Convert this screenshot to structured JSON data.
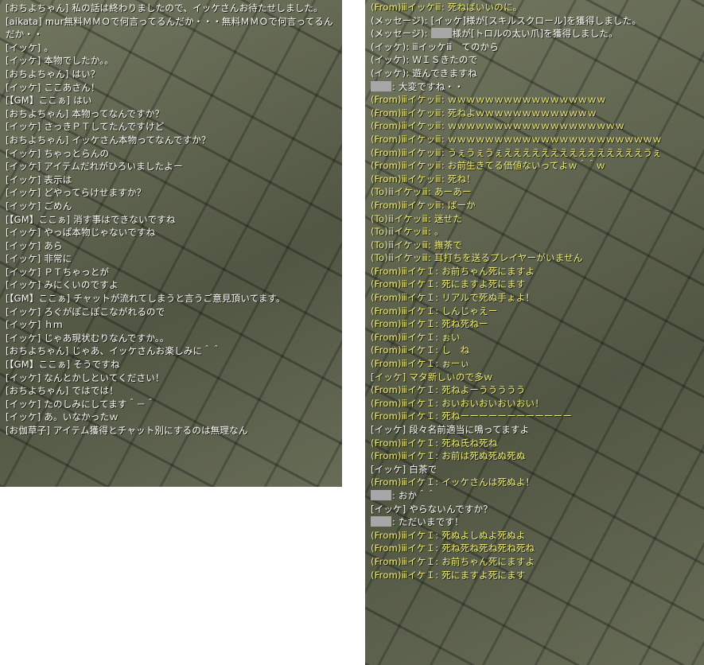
{
  "colors": {
    "normal": "#ffffff",
    "whisper": "#f2ef7a",
    "background": "#5f6450"
  },
  "left_panel": {
    "lines": [
      {
        "type": "normal",
        "text": "[おちよちゃん] 私の話は終わりましたので、イッケさんお待たせしました。"
      },
      {
        "type": "normal",
        "text": "[aikata] mur無料ＭＭＯで何言ってるんだか・・・無料ＭＭＯで何言ってるんだか・・"
      },
      {
        "type": "normal",
        "text": "[イッケ] 。"
      },
      {
        "type": "normal",
        "text": "[イッケ] 本物でしたか。。"
      },
      {
        "type": "normal",
        "text": "[おちよちゃん] はい？"
      },
      {
        "type": "normal",
        "text": "[イッケ] ここあさん！"
      },
      {
        "type": "normal",
        "text": "[【GM】ここぁ] はい"
      },
      {
        "type": "normal",
        "text": "[おちよちゃん] 本物ってなんですか？"
      },
      {
        "type": "normal",
        "text": "[イッケ] さっきＰＴしてたんですけど"
      },
      {
        "type": "normal",
        "text": "[おちよちゃん] イッケさん本物ってなんですか？"
      },
      {
        "type": "normal",
        "text": "[イッケ] ちゃっとらんの"
      },
      {
        "type": "normal",
        "text": "[イッケ] アイテムだれがひろいましたよー"
      },
      {
        "type": "normal",
        "text": "[イッケ] 表示は"
      },
      {
        "type": "normal",
        "text": "[イッケ] どやってらけせますか？"
      },
      {
        "type": "normal",
        "text": "[イッケ] ごめん"
      },
      {
        "type": "normal",
        "text": "[【GM】ここぁ] 消す事はできないですね"
      },
      {
        "type": "normal",
        "text": "[イッケ] やっぱ本物じゃないですね"
      },
      {
        "type": "normal",
        "text": "[イッケ] あら"
      },
      {
        "type": "normal",
        "text": "[イッケ] 非常に"
      },
      {
        "type": "normal",
        "text": "[イッケ] ＰＴちゃっとが"
      },
      {
        "type": "normal",
        "text": "[イッケ] みにくいのですよ"
      },
      {
        "type": "normal",
        "text": "[【GM】ここぁ] チャットが流れてしまうと言うご意見頂いてます。"
      },
      {
        "type": "normal",
        "text": "[イッケ] ろぐがぽこぽこながれるので"
      },
      {
        "type": "normal",
        "text": "[イッケ] ｈｍ"
      },
      {
        "type": "normal",
        "text": "[イッケ] じゃあ現状むりなんですか。。"
      },
      {
        "type": "normal",
        "text": "[おちよちゃん] じゃあ、イッケさんお楽しみに＾＾"
      },
      {
        "type": "normal",
        "text": "[【GM】ここぁ] そうですね"
      },
      {
        "type": "normal",
        "text": "[イッケ] なんとかしといてください！"
      },
      {
        "type": "normal",
        "text": "[おちよちゃん] ではでは！"
      },
      {
        "type": "normal",
        "text": "[イッケ] たのしみにしてます＾－＾"
      },
      {
        "type": "normal",
        "text": "[イッケ] あ。いなかったｗ"
      },
      {
        "type": "normal",
        "text": "[お伽草子] アイテム獲得とチャット別にするのは無理なん"
      }
    ]
  },
  "right_panel": {
    "lines": [
      {
        "type": "whisper",
        "text": "(From)ⅲイッケⅲ: 死ねばいいのに。"
      },
      {
        "type": "system",
        "text": "(メッセージ): [イッケ]様が[スキルスクロール]を獲得しました。"
      },
      {
        "type": "system",
        "redacted": true,
        "text_before": "(メッセージ): ",
        "text": "様が[トロルの太い爪]を獲得しました。"
      },
      {
        "type": "system",
        "text": "(イッケ): ⅲイッケⅲ　てのから"
      },
      {
        "type": "system",
        "text": "(イッケ): ＷＩＳきたので"
      },
      {
        "type": "system",
        "text": "(イッケ): 遊んできますね"
      },
      {
        "type": "system",
        "redacted": true,
        "text_before": "",
        "text": ": 大変ですね・・"
      },
      {
        "type": "whisper",
        "text": "(From)ⅲイケッⅲ: ｗｗｗｗｗｗｗｗｗｗｗｗｗｗｗｗｗ"
      },
      {
        "type": "whisper",
        "text": "(From)ⅲイケッⅲ: 死ねよｗｗｗｗｗｗｗｗｗｗｗｗｗ"
      },
      {
        "type": "whisper",
        "text": "(From)ⅲイケッⅲ: ｗｗｗｗｗｗｗｗｗｗｗｗｗｗｗｗｗｗｗ"
      },
      {
        "type": "whisper",
        "text": "(From)ⅲイケッⅲ: ｗｗｗｗｗｗｗｗｗｗｗｗｗｗｗｗｗｗｗｗｗｗｗ"
      },
      {
        "type": "whisper",
        "text": "(From)ⅲイケッⅲ: うぇうぇうぇえええええええええええええええうぇ"
      },
      {
        "type": "whisper",
        "text": "(From)ⅲイケッⅲ: お前生きてる価値ないってよｗ＾＾ｗ"
      },
      {
        "type": "whisper",
        "text": "(From)ⅲイケッⅲ: 死ね！"
      },
      {
        "type": "whisper",
        "text": "(To)ⅲイケッⅲ: あーあー"
      },
      {
        "type": "whisper",
        "text": "(From)ⅲイケッⅲ: ばーか"
      },
      {
        "type": "whisper",
        "text": "(To)ⅲイケッⅲ: 迷せた"
      },
      {
        "type": "whisper",
        "text": "(To)ⅲイケッⅲ: 。"
      },
      {
        "type": "whisper",
        "text": "(To)ⅲイケッⅲ: 撫茶で"
      },
      {
        "type": "whisper",
        "text": "(To)ⅲイケッⅲ: 耳打ちを送るプレイヤーがいません"
      },
      {
        "type": "whisper",
        "text": "(From)ⅲイケＩ: お前ちゃん死にますよ"
      },
      {
        "type": "whisper",
        "text": "(From)ⅲイケＩ: 死にますよ死にます"
      },
      {
        "type": "whisper",
        "text": "(From)ⅲイケＩ: リアルで死ぬ手ょよ！"
      },
      {
        "type": "whisper",
        "text": "(From)ⅲイケＩ: しんじゃえー"
      },
      {
        "type": "whisper",
        "text": "(From)ⅲイケＩ: 死ね死ねー"
      },
      {
        "type": "whisper",
        "text": "(From)ⅲイケＩ: ぉい"
      },
      {
        "type": "whisper",
        "text": "(From)ⅲイケＩ: し　ね"
      },
      {
        "type": "whisper",
        "text": "(From)ⅲイケＩ: ぉーぃ"
      },
      {
        "type": "whisper",
        "text": "[イッケ] マタ新しいので多ｗ"
      },
      {
        "type": "whisper",
        "text": "(From)ⅲイケＩ: 死ねよーううううう"
      },
      {
        "type": "whisper",
        "text": "(From)ⅲイケＩ: おいおいおいおいおい！"
      },
      {
        "type": "whisper",
        "text": "(From)ⅲイケＩ: 死ねーーーーーーーーーーーー"
      },
      {
        "type": "normal",
        "text": "[イッケ] 段々名前適当に鳴ってますよ"
      },
      {
        "type": "whisper",
        "text": "(From)ⅲイケＩ: 死ね氏ね死ね"
      },
      {
        "type": "whisper",
        "text": "(From)ⅲイケＩ: お前は死ぬ死ぬ死ぬ"
      },
      {
        "type": "normal",
        "text": "[イッケ] 白茶で"
      },
      {
        "type": "whisper",
        "text": "(From)ⅲイケＩ: イッケさんは死ぬよ！"
      },
      {
        "type": "normal",
        "redacted": true,
        "text_before": "",
        "text": ": おか＾＾"
      },
      {
        "type": "normal",
        "text": "[イッケ] やらないんですか？"
      },
      {
        "type": "normal",
        "redacted": true,
        "text_before": "",
        "text": ": ただいまです！"
      },
      {
        "type": "whisper",
        "text": "(From)ⅲイケＩ: 死ぬよしぬよ死ぬよ"
      },
      {
        "type": "whisper",
        "text": "(From)ⅲイケＩ: 死ね死ね死ね死ね死ね"
      },
      {
        "type": "whisper",
        "text": "(From)ⅲイケＩ: お前ちゃん死にますよ"
      },
      {
        "type": "whisper",
        "text": "(From)ⅲイケＩ: 死にますよ死にます"
      }
    ]
  }
}
